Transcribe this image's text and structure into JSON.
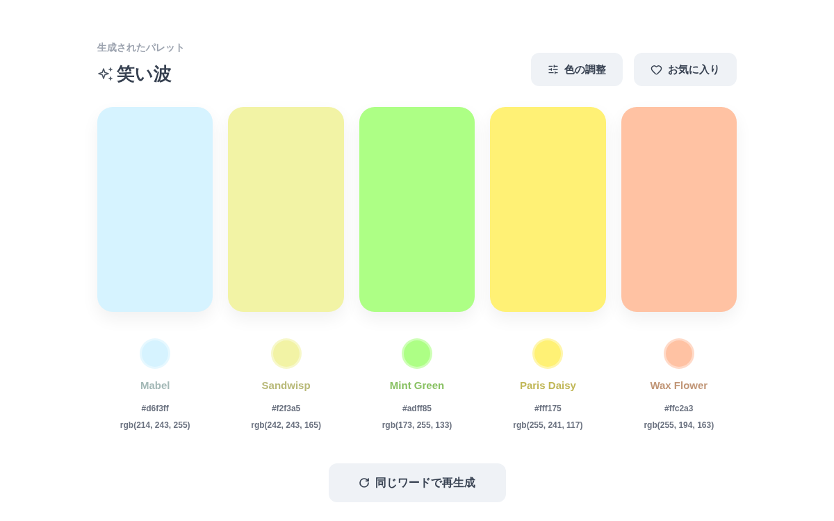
{
  "header": {
    "subtitle": "生成されたパレット",
    "title": "笑い波"
  },
  "actions": [
    {
      "kind": "adjust",
      "label": "色の調整"
    },
    {
      "kind": "favorite",
      "label": "お気に入り"
    }
  ],
  "swatches": [
    {
      "color": "#d6f3ff",
      "name": "Mabel",
      "hex": "#d6f3ff",
      "rgb": "rgb(214, 243, 255)"
    },
    {
      "color": "#f2f3a5",
      "name": "Sandwisp",
      "hex": "#f2f3a5",
      "rgb": "rgb(242, 243, 165)"
    },
    {
      "color": "#adff85",
      "name": "Mint Green",
      "hex": "#adff85",
      "rgb": "rgb(173, 255, 133)"
    },
    {
      "color": "#fff175",
      "name": "Paris Daisy",
      "hex": "#fff175",
      "rgb": "rgb(255, 241, 117)"
    },
    {
      "color": "#ffc2a3",
      "name": "Wax Flower",
      "hex": "#ffc2a3",
      "rgb": "rgb(255, 194, 163)"
    }
  ],
  "regenerate": {
    "label": "同じワードで再生成"
  }
}
